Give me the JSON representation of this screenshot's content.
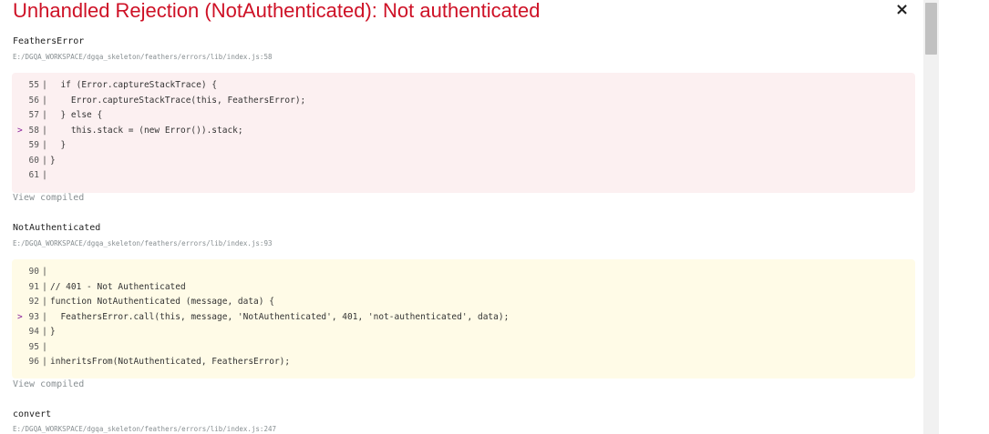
{
  "title": "Unhandled Rejection (NotAuthenticated): Not authenticated",
  "close_label": "×",
  "frames": [
    {
      "name": "FeathersError",
      "path": "E:/DGQA_WORKSPACE/dgqa_skeleton/feathers/errors/lib/index.js:58",
      "view_compiled": "View compiled",
      "lines": [
        {
          "num": "55",
          "code": "  if (Error.captureStackTrace) {"
        },
        {
          "num": "56",
          "code": "    Error.captureStackTrace(this, FeathersError);"
        },
        {
          "num": "57",
          "code": "  } else {"
        },
        {
          "num": "58",
          "code": "    this.stack = (new Error()).stack;",
          "marker": ">"
        },
        {
          "num": "59",
          "code": "  }"
        },
        {
          "num": "60",
          "code": "}"
        },
        {
          "num": "61",
          "code": ""
        }
      ]
    },
    {
      "name": "NotAuthenticated",
      "path": "E:/DGQA_WORKSPACE/dgqa_skeleton/feathers/errors/lib/index.js:93",
      "view_compiled": "View compiled",
      "lines": [
        {
          "num": "90",
          "code": ""
        },
        {
          "num": "91",
          "code": "// 401 - Not Authenticated"
        },
        {
          "num": "92",
          "code": "function NotAuthenticated (message, data) {"
        },
        {
          "num": "93",
          "code": "  FeathersError.call(this, message, 'NotAuthenticated', 401, 'not-authenticated', data);",
          "marker": ">"
        },
        {
          "num": "94",
          "code": "}"
        },
        {
          "num": "95",
          "code": ""
        },
        {
          "num": "96",
          "code": "inheritsFrom(NotAuthenticated, FeathersError);"
        }
      ]
    },
    {
      "name": "convert",
      "path": "E:/DGQA_WORKSPACE/dgqa_skeleton/feathers/errors/lib/index.js:247"
    }
  ]
}
